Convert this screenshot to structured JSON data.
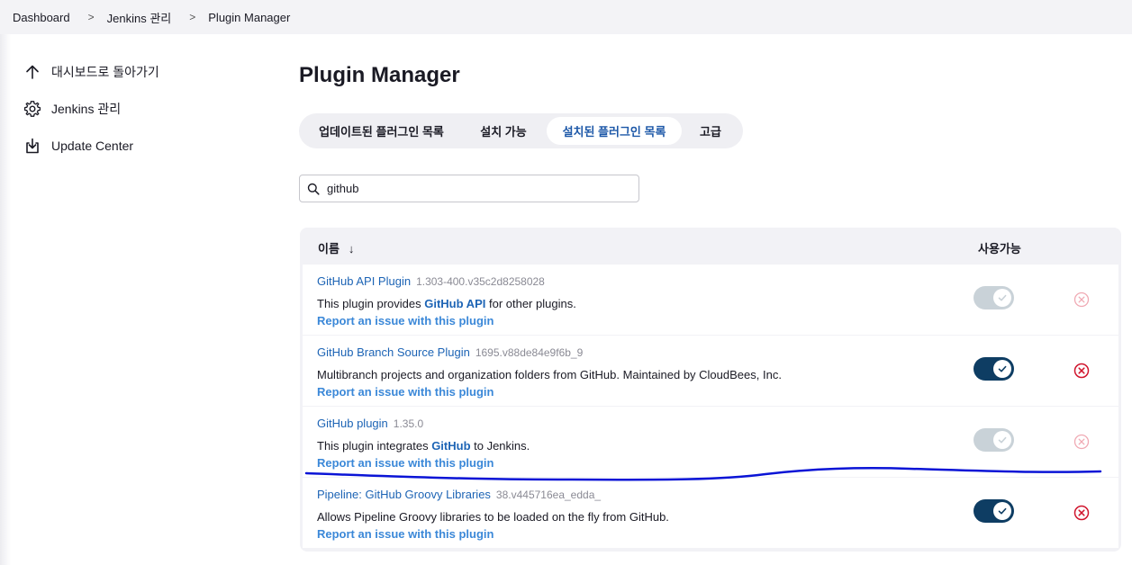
{
  "breadcrumb": {
    "items": [
      "Dashboard",
      "Jenkins 관리",
      "Plugin Manager"
    ],
    "separator": ">"
  },
  "sidebar": {
    "items": [
      {
        "label": "대시보드로 돌아가기",
        "icon": "arrow-up-icon"
      },
      {
        "label": "Jenkins 관리",
        "icon": "gear-icon"
      },
      {
        "label": "Update Center",
        "icon": "download-icon"
      }
    ]
  },
  "page": {
    "title": "Plugin Manager"
  },
  "tabs": [
    {
      "label": "업데이트된 플러그인 목록",
      "active": false
    },
    {
      "label": "설치 가능",
      "active": false
    },
    {
      "label": "설치된 플러그인 목록",
      "active": true
    },
    {
      "label": "고급",
      "active": false
    }
  ],
  "search": {
    "value": "github",
    "icon": "search-icon"
  },
  "table": {
    "col_name": "이름",
    "col_name_sort": "↓",
    "col_enabled": "사용가능",
    "rows": [
      {
        "name": "GitHub API Plugin",
        "version": "1.303-400.v35c2d8258028",
        "desc_before": "This plugin provides ",
        "desc_bold": "GitHub API",
        "desc_after": " for other plugins.",
        "report": "Report an issue with this plugin",
        "enabled": true,
        "toggle_locked": true
      },
      {
        "name": "GitHub Branch Source Plugin",
        "version": "1695.v88de84e9f6b_9",
        "desc_before": "Multibranch projects and organization folders from GitHub. Maintained by CloudBees, Inc.",
        "desc_bold": "",
        "desc_after": "",
        "report": "Report an issue with this plugin",
        "enabled": true,
        "toggle_locked": false
      },
      {
        "name": "GitHub plugin",
        "version": "1.35.0",
        "desc_before": "This plugin integrates ",
        "desc_bold": "GitHub",
        "desc_after": " to Jenkins.",
        "report": "Report an issue with this plugin",
        "enabled": true,
        "toggle_locked": true
      },
      {
        "name": "Pipeline: GitHub Groovy Libraries",
        "version": "38.v445716ea_edda_",
        "desc_before": "Allows Pipeline Groovy libraries to be loaded on the fly from GitHub.",
        "desc_bold": "",
        "desc_after": "",
        "report": "Report an issue with this plugin",
        "enabled": true,
        "toggle_locked": false
      }
    ]
  },
  "colors": {
    "link": "#1d64b5",
    "report_link": "#3b88d8",
    "toggle_on": "#0e3d63",
    "toggle_disabled": "#c9d2d8",
    "uninstall": "#d0142c",
    "uninstall_disabled": "#f0a9b3",
    "annotation": "#0a14d6"
  }
}
